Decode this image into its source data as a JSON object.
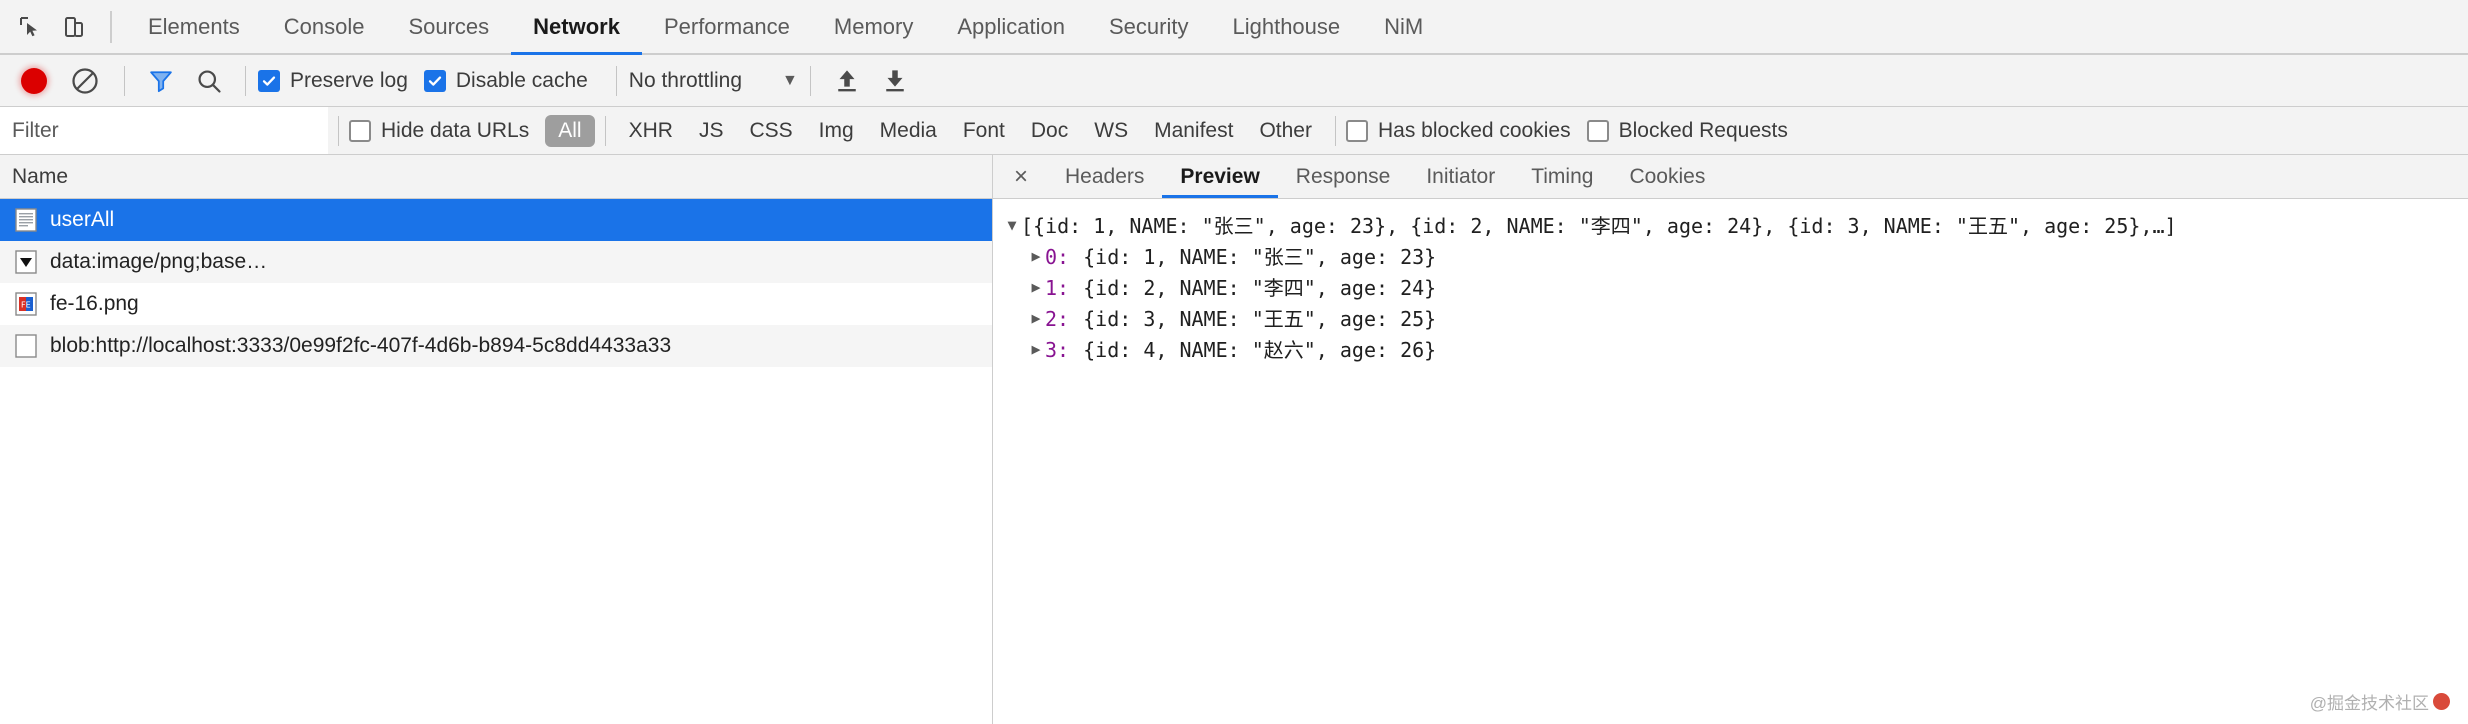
{
  "devtools": {
    "tabs": [
      {
        "label": "Elements",
        "active": false
      },
      {
        "label": "Console",
        "active": false
      },
      {
        "label": "Sources",
        "active": false
      },
      {
        "label": "Network",
        "active": true
      },
      {
        "label": "Performance",
        "active": false
      },
      {
        "label": "Memory",
        "active": false
      },
      {
        "label": "Application",
        "active": false
      },
      {
        "label": "Security",
        "active": false
      },
      {
        "label": "Lighthouse",
        "active": false
      },
      {
        "label": "NiM",
        "active": false
      }
    ],
    "icons": {
      "inspect": "inspect-element-icon",
      "device": "device-toolbar-icon"
    }
  },
  "toolbar": {
    "record_title": "record-button",
    "clear_title": "clear-button",
    "filter_title": "filter-funnel-icon",
    "search_title": "search-icon",
    "preserve_log": {
      "label": "Preserve log",
      "checked": true
    },
    "disable_cache": {
      "label": "Disable cache",
      "checked": true
    },
    "throttling": {
      "value": "No throttling",
      "caret": "▼"
    },
    "import_title": "import-har-icon",
    "export_title": "export-har-icon"
  },
  "filterbar": {
    "filter_placeholder": "Filter",
    "filter_value": "",
    "hide_data_urls": {
      "label": "Hide data URLs",
      "checked": false
    },
    "resource_types": [
      {
        "label": "All",
        "active": true
      },
      {
        "label": "XHR",
        "active": false
      },
      {
        "label": "JS",
        "active": false
      },
      {
        "label": "CSS",
        "active": false
      },
      {
        "label": "Img",
        "active": false
      },
      {
        "label": "Media",
        "active": false
      },
      {
        "label": "Font",
        "active": false
      },
      {
        "label": "Doc",
        "active": false
      },
      {
        "label": "WS",
        "active": false
      },
      {
        "label": "Manifest",
        "active": false
      },
      {
        "label": "Other",
        "active": false
      }
    ],
    "has_blocked_cookies": {
      "label": "Has blocked cookies",
      "checked": false
    },
    "blocked_requests": {
      "label": "Blocked Requests",
      "checked": false
    }
  },
  "requests": {
    "column_header": "Name",
    "rows": [
      {
        "name": "userAll",
        "icon": "xhr-document-icon",
        "selected": true
      },
      {
        "name": "data:image/png;base…",
        "icon": "image-placeholder-icon",
        "selected": false
      },
      {
        "name": "fe-16.png",
        "icon": "favicon-png-icon",
        "selected": false
      },
      {
        "name": "blob:http://localhost:3333/0e99f2fc-407f-4d6b-b894-5c8dd4433a33",
        "icon": "blank-document-icon",
        "selected": false
      }
    ]
  },
  "detail": {
    "close_label": "×",
    "tabs": [
      {
        "label": "Headers",
        "active": false
      },
      {
        "label": "Preview",
        "active": true
      },
      {
        "label": "Response",
        "active": false
      },
      {
        "label": "Initiator",
        "active": false
      },
      {
        "label": "Timing",
        "active": false
      },
      {
        "label": "Cookies",
        "active": false
      }
    ],
    "preview": {
      "root_triangle": "▼",
      "root_text": "[{id: 1, NAME: \"张三\", age: 23}, {id: 2, NAME: \"李四\", age: 24}, {id: 3, NAME: \"王五\", age: 25},…]",
      "children": [
        {
          "triangle": "▶",
          "index": "0:",
          "text": "{id: 1, NAME: \"张三\", age: 23}"
        },
        {
          "triangle": "▶",
          "index": "1:",
          "text": "{id: 2, NAME: \"李四\", age: 24}"
        },
        {
          "triangle": "▶",
          "index": "2:",
          "text": "{id: 3, NAME: \"王五\", age: 25}"
        },
        {
          "triangle": "▶",
          "index": "3:",
          "text": "{id: 4, NAME: \"赵六\", age: 26}"
        }
      ]
    }
  },
  "watermark": {
    "prefix": "@掘金技术社区",
    "suffix": ""
  },
  "colors": {
    "accent": "#1a73e8",
    "record": "#db0000",
    "toolbar_bg": "#f3f3f3",
    "border": "#cdcdcd"
  }
}
